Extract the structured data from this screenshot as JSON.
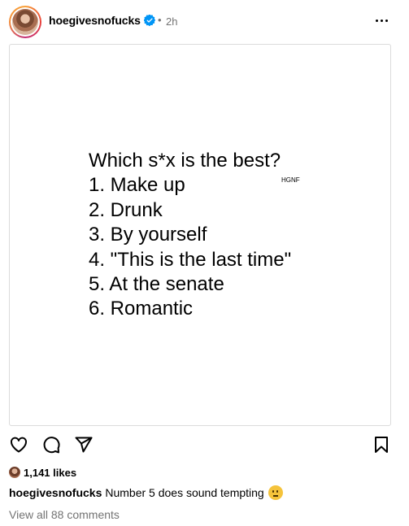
{
  "post": {
    "header": {
      "username": "hoegivesnofucks",
      "separator": "•",
      "time": "2h",
      "verified_icon": "verified-badge-icon",
      "more_icon": "more-options-icon"
    },
    "image": {
      "lines": [
        "Which s*x is the best?",
        "1. Make up",
        "2. Drunk",
        "3. By yourself",
        "4. \"This is the last time\"",
        "5. At the senate",
        "6. Romantic"
      ],
      "watermark": "HGNF"
    },
    "actions": {
      "like_icon": "heart-icon",
      "comment_icon": "comment-icon",
      "share_icon": "share-icon",
      "save_icon": "bookmark-icon"
    },
    "likes": "1,141 likes",
    "caption": {
      "username": "hoegivesnofucks",
      "text": "Number 5 does sound tempting",
      "emoji": "thinking-face-emoji"
    },
    "view_comments": "View all 88 comments"
  },
  "colors": {
    "verified": "#0095f6",
    "secondary_text": "#737373",
    "border": "#dbdbdb"
  }
}
